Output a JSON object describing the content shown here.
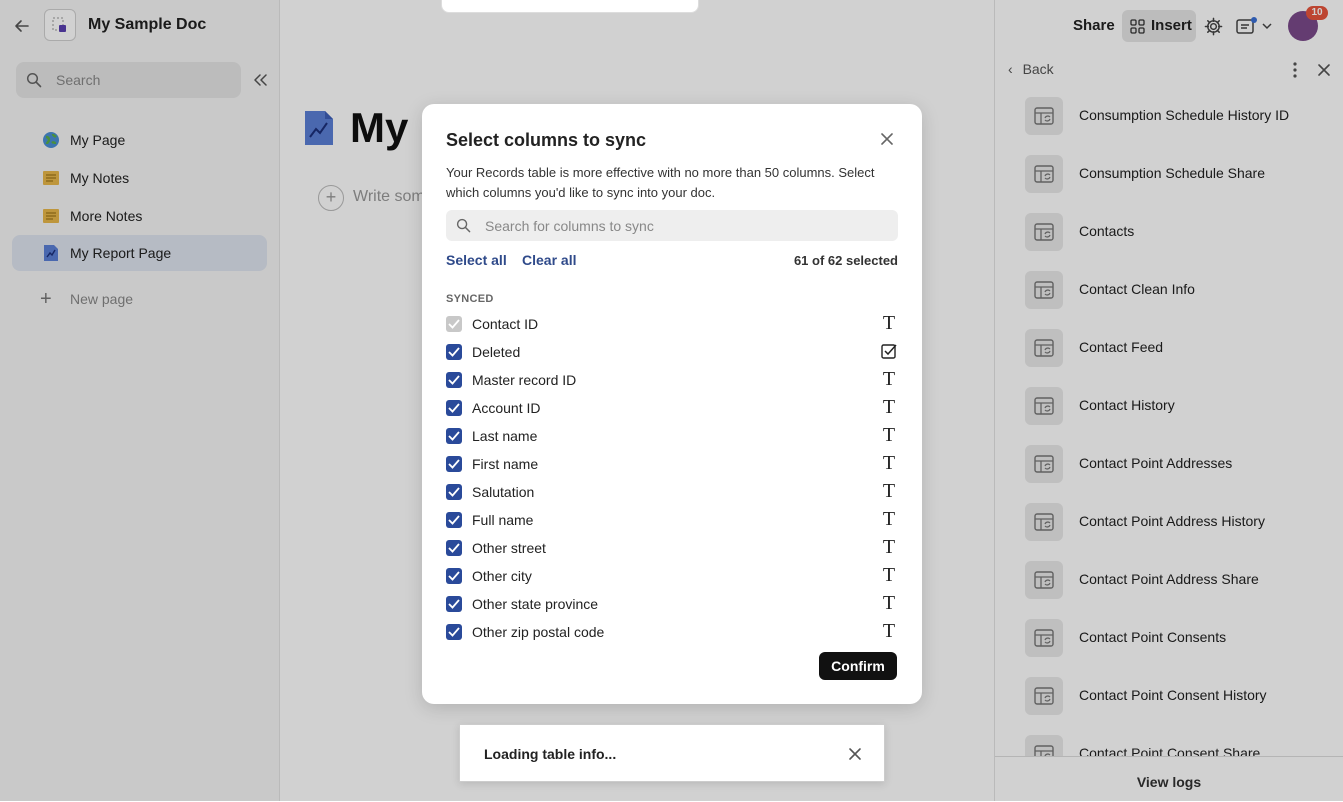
{
  "doc": {
    "title": "My Sample Doc"
  },
  "sidebar": {
    "search_placeholder": "Search",
    "items": [
      {
        "label": "My Page",
        "icon": "globe-icon"
      },
      {
        "label": "My Notes",
        "icon": "note-icon"
      },
      {
        "label": "More Notes",
        "icon": "note-icon"
      },
      {
        "label": "My Report Page",
        "icon": "chart-page-icon",
        "active": true
      }
    ],
    "new_page_label": "New page"
  },
  "main": {
    "page_title": "My I",
    "write_placeholder": "Write som"
  },
  "header": {
    "share_label": "Share",
    "insert_label": "Insert",
    "avatar_badge": "10"
  },
  "panel": {
    "back_label": "Back",
    "items": [
      "Consumption Schedule History ID",
      "Consumption Schedule Share",
      "Contacts",
      "Contact Clean Info",
      "Contact Feed",
      "Contact History",
      "Contact Point Addresses",
      "Contact Point Address History",
      "Contact Point Address Share",
      "Contact Point Consents",
      "Contact Point Consent History",
      "Contact Point Consent Share"
    ],
    "view_logs_label": "View logs"
  },
  "modal": {
    "title": "Select columns to sync",
    "description": "Your Records table is more effective with no more than 50 columns. Select which columns you'd like to sync into your doc.",
    "search_placeholder": "Search for columns to sync",
    "select_all_label": "Select all",
    "clear_all_label": "Clear all",
    "selected_count": "61 of 62 selected",
    "section_label": "SYNCED",
    "columns": [
      {
        "label": "Contact ID",
        "type": "text",
        "checked": true,
        "disabled": true
      },
      {
        "label": "Deleted",
        "type": "checkbox",
        "checked": true
      },
      {
        "label": "Master record ID",
        "type": "text",
        "checked": true
      },
      {
        "label": "Account ID",
        "type": "text",
        "checked": true
      },
      {
        "label": "Last name",
        "type": "text",
        "checked": true
      },
      {
        "label": "First name",
        "type": "text",
        "checked": true
      },
      {
        "label": "Salutation",
        "type": "text",
        "checked": true
      },
      {
        "label": "Full name",
        "type": "text",
        "checked": true
      },
      {
        "label": "Other street",
        "type": "text",
        "checked": true
      },
      {
        "label": "Other city",
        "type": "text",
        "checked": true
      },
      {
        "label": "Other state province",
        "type": "text",
        "checked": true
      },
      {
        "label": "Other zip postal code",
        "type": "text",
        "checked": true
      }
    ],
    "text_type_glyph": "T",
    "confirm_label": "Confirm"
  },
  "toast": {
    "message": "Loading table info..."
  },
  "colors": {
    "accent": "#2a4a9a",
    "link": "#2f4a8a",
    "badge": "#e7553c"
  }
}
